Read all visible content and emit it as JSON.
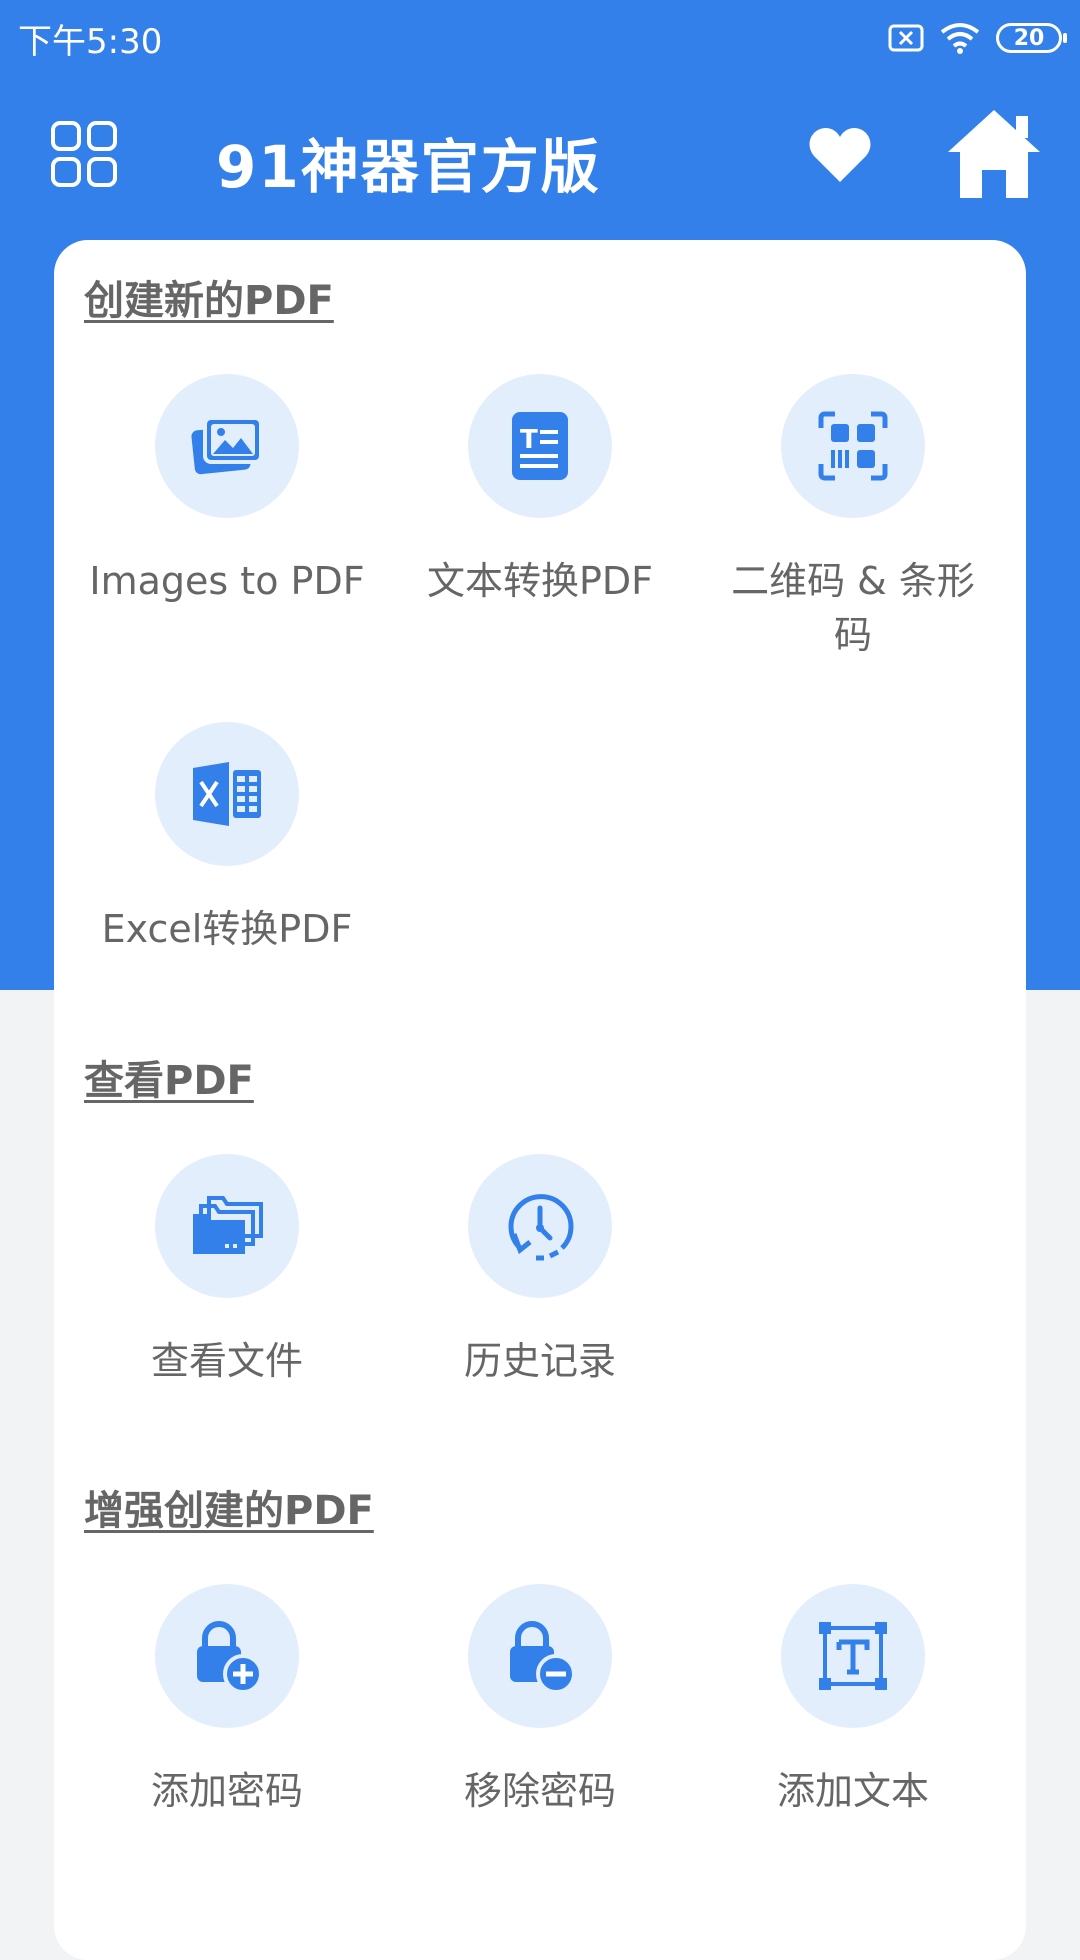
{
  "status_bar": {
    "time": "下午5:30",
    "battery": "20"
  },
  "app_bar": {
    "title": "91神器官方版"
  },
  "sections": {
    "create": {
      "title": "创建新的PDF",
      "items": [
        {
          "label": "Images to PDF",
          "icon": "image-icon"
        },
        {
          "label": "文本转换PDF",
          "icon": "text-document-icon"
        },
        {
          "label": "二维码 & 条形码",
          "icon": "qr-code-icon"
        },
        {
          "label": "Excel转换PDF",
          "icon": "excel-icon"
        }
      ]
    },
    "view": {
      "title": "查看PDF",
      "items": [
        {
          "label": "查看文件",
          "icon": "folder-icon"
        },
        {
          "label": "历史记录",
          "icon": "history-icon"
        }
      ]
    },
    "enhance": {
      "title": "增强创建的PDF",
      "items": [
        {
          "label": "添加密码",
          "icon": "lock-add-icon"
        },
        {
          "label": "移除密码",
          "icon": "lock-remove-icon"
        },
        {
          "label": "添加文本",
          "icon": "add-text-icon"
        }
      ]
    }
  },
  "colors": {
    "primary": "#3380ea",
    "icon_bg": "#e3eefc",
    "label": "#666666"
  }
}
